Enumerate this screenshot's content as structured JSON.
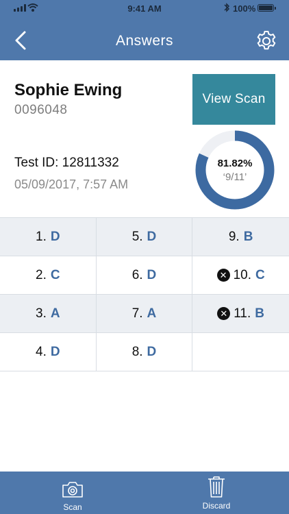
{
  "status_bar": {
    "time": "9:41 AM",
    "battery": "100%"
  },
  "header": {
    "title": "Answers",
    "back_icon": "chevron-left-icon",
    "settings_icon": "gear-icon"
  },
  "student": {
    "name": "Sophie Ewing",
    "id": "0096048"
  },
  "view_scan_label": "View Scan",
  "test": {
    "id_label": "Test ID: 12811332",
    "datetime": "05/09/2017, 7:57 AM"
  },
  "score": {
    "percent": "81.82%",
    "fraction": "‘9/11’",
    "progress": 0.8182
  },
  "answers": [
    [
      {
        "num": "1.",
        "ans": "D",
        "wrong": false
      },
      {
        "num": "5.",
        "ans": "D",
        "wrong": false
      },
      {
        "num": "9.",
        "ans": "B",
        "wrong": false
      }
    ],
    [
      {
        "num": "2.",
        "ans": "C",
        "wrong": false
      },
      {
        "num": "6.",
        "ans": "D",
        "wrong": false
      },
      {
        "num": "10.",
        "ans": "C",
        "wrong": true
      }
    ],
    [
      {
        "num": "3.",
        "ans": "A",
        "wrong": false
      },
      {
        "num": "7.",
        "ans": "A",
        "wrong": false
      },
      {
        "num": "11.",
        "ans": "B",
        "wrong": true
      }
    ],
    [
      {
        "num": "4.",
        "ans": "D",
        "wrong": false
      },
      {
        "num": "8.",
        "ans": "D",
        "wrong": false
      }
    ]
  ],
  "tabs": {
    "scan_label": "Scan",
    "discard_label": "Discard",
    "scan_icon": "camera-icon",
    "discard_icon": "trash-icon"
  },
  "colors": {
    "bar": "#4f78ab",
    "accent": "#35889c",
    "answer": "#3e6aa0",
    "ring": "#3d6aa1",
    "ring_track": "#eef0f4"
  }
}
